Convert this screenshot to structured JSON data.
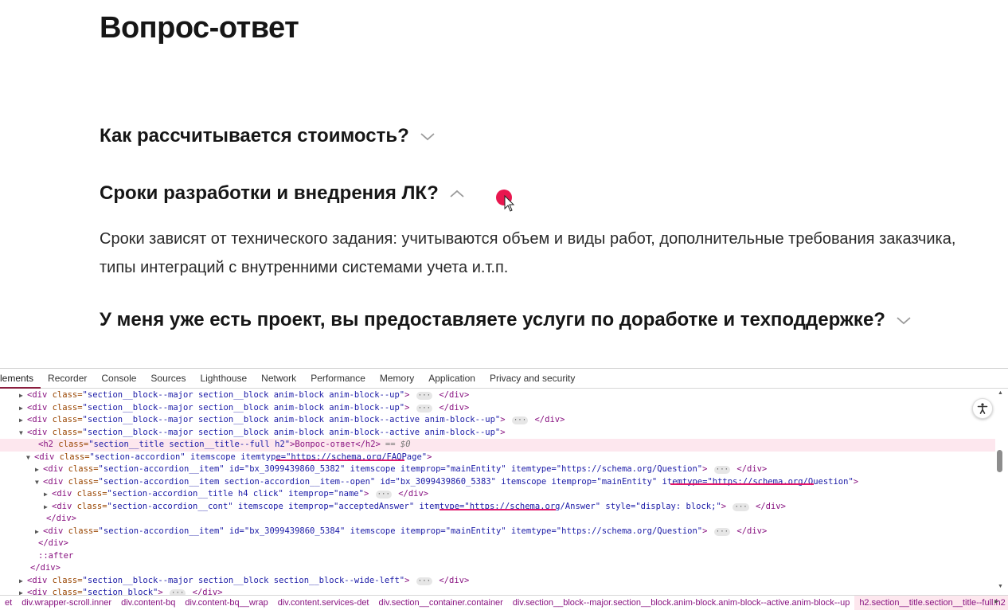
{
  "page": {
    "title": "Вопрос-ответ",
    "faq": [
      {
        "question": "Как рассчитывается стоимость?",
        "state": "collapsed"
      },
      {
        "question": "Сроки разработки и внедрения ЛК?",
        "state": "expanded",
        "answer": "Сроки зависят от технического задания: учитываются объем и виды работ, дополнительные требования заказчика, типы интеграций с внутренними системами учета и.т.п."
      },
      {
        "question": "У меня уже есть проект, вы предоставляете услуги по доработке и техподдержке?",
        "state": "collapsed"
      }
    ]
  },
  "devtools": {
    "tabs": [
      "Elements",
      "Recorder",
      "Console",
      "Sources",
      "Lighthouse",
      "Network",
      "Performance",
      "Memory",
      "Application",
      "Privacy and security"
    ],
    "active_tab": "Elements",
    "selected_suffix": "== $0",
    "lines": [
      {
        "tri": "▶",
        "tag": "<div ",
        "attr": "class=",
        "val": "\"section__block--major section__block anim-block anim-block--up\"",
        "rest": "> ",
        "dots": true,
        "close": " </div>"
      },
      {
        "tri": "▶",
        "tag": "<div ",
        "attr": "class=",
        "val": "\"section__block--major section__block anim-block anim-block--up\"",
        "rest": "> ",
        "dots": true,
        "close": " </div>"
      },
      {
        "tri": "▶",
        "tag": "<div ",
        "attr": "class=",
        "val": "\"section__block--major section__block anim-block anim-block--active anim-block--up\"",
        "rest": "> ",
        "dots": true,
        "close": " </div>"
      },
      {
        "tri": "▼",
        "tag": "<div ",
        "attr": "class=",
        "val": "\"section__block--major section__block anim-block anim-block--active anim-block--up\"",
        "rest": ">",
        "dots": false,
        "close": ""
      },
      {
        "tri": "",
        "tag": "<h2 ",
        "attr": "class=",
        "val": "\"section__title section__title--full h2\"",
        "rest": ">Вопрос-ответ</h2>",
        "dots": false,
        "close": ""
      },
      {
        "tri": "▼",
        "tag": "<div ",
        "attr": "class=",
        "val": "\"section-accordion\" itemscope itemtype=\"https://schema.org/FAQPage\"",
        "rest": ">",
        "dots": false,
        "close": ""
      },
      {
        "tri": "▶",
        "tag": "<div ",
        "attr": "class=",
        "val": "\"section-accordion__item\" id=\"bx_3099439860_5382\" itemscope itemprop=\"mainEntity\" itemtype=\"https://schema.org/Question\"",
        "rest": "> ",
        "dots": true,
        "close": " </div>"
      },
      {
        "tri": "▼",
        "tag": "<div ",
        "attr": "class=",
        "val": "\"section-accordion__item section-accordion__item--open\" id=\"bx_3099439860_5383\" itemscope itemprop=\"mainEntity\" itemtype=\"https://schema.org/Question\"",
        "rest": ">",
        "dots": false,
        "close": ""
      },
      {
        "tri": "▶",
        "tag": "<div ",
        "attr": "class=",
        "val": "\"section-accordion__title h4 click\" itemprop=\"name\"",
        "rest": "> ",
        "dots": true,
        "close": " </div>"
      },
      {
        "tri": "▶",
        "tag": "<div ",
        "attr": "class=",
        "val": "\"section-accordion__cont\" itemscope itemprop=\"acceptedAnswer\" itemtype=\"https://schema.org/Answer\" style=\"display: block;\"",
        "rest": "> ",
        "dots": true,
        "close": " </div>"
      },
      {
        "tri": "",
        "tag": "</div>",
        "attr": "",
        "val": "",
        "rest": "",
        "dots": false,
        "close": ""
      },
      {
        "tri": "▶",
        "tag": "<div ",
        "attr": "class=",
        "val": "\"section-accordion__item\" id=\"bx_3099439860_5384\" itemscope itemprop=\"mainEntity\" itemtype=\"https://schema.org/Question\"",
        "rest": "> ",
        "dots": true,
        "close": " </div>"
      },
      {
        "tri": "",
        "tag": "</div>",
        "attr": "",
        "val": "",
        "rest": "",
        "dots": false,
        "close": ""
      },
      {
        "tri": "",
        "tag": "::after",
        "attr": "",
        "val": "",
        "rest": "",
        "dots": false,
        "close": ""
      },
      {
        "tri": "",
        "tag": "</div>",
        "attr": "",
        "val": "",
        "rest": "",
        "dots": false,
        "close": ""
      },
      {
        "tri": "▶",
        "tag": "<div ",
        "attr": "class=",
        "val": "\"section__block--major  section__block section__block--wide-left\"",
        "rest": "> ",
        "dots": true,
        "close": " </div>"
      },
      {
        "tri": "▶",
        "tag": "<div ",
        "attr": "class=",
        "val": "\"section  block\"",
        "rest": "> ",
        "dots": true,
        "close": " </div>"
      }
    ],
    "breadcrumbs": [
      "et",
      "div.wrapper-scroll.inner",
      "div.content-bq",
      "div.content-bq__wrap",
      "div.content.services-det",
      "div.section__container.container",
      "div.section__block--major.section__block.anim-block.anim-block--active.anim-block--up",
      "h2.section__title.section__title--full.h2"
    ]
  },
  "colors": {
    "accent": "#e0176a",
    "cursor_dot": "#e8174f",
    "selected_row": "#fde7ee"
  }
}
